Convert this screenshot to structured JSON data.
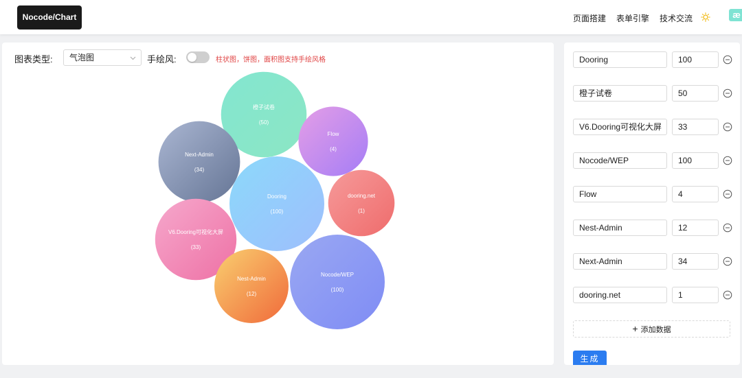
{
  "header": {
    "logo": "Nocode/Chart",
    "nav": [
      "页面搭建",
      "表单引擎",
      "技术交流"
    ],
    "brand_mark": "æ"
  },
  "controls": {
    "chart_type_label": "图表类型:",
    "chart_type_value": "气泡图",
    "hand_drawn_label": "手绘风:",
    "hand_drawn_enabled": false,
    "hand_drawn_hint": "柱状图，饼图，面积图支持手绘风格"
  },
  "chart_data": {
    "type": "bubble",
    "points": [
      {
        "name": "橙子试卷",
        "value": 50,
        "gradient": [
          "#83e6d0",
          "#8ce6c4"
        ]
      },
      {
        "name": "Flow",
        "value": 4,
        "gradient": [
          "#e49ee6",
          "#a57df6"
        ]
      },
      {
        "name": "Next-Admin",
        "value": 34,
        "gradient": [
          "#aab6d2",
          "#657595"
        ]
      },
      {
        "name": "Dooring",
        "value": 100,
        "gradient": [
          "#8cd9fb",
          "#9ebefc"
        ]
      },
      {
        "name": "dooring.net",
        "value": 1,
        "gradient": [
          "#f69a9a",
          "#ef6c6c"
        ]
      },
      {
        "name": "V6.Dooring可视化大屏",
        "value": 33,
        "gradient": [
          "#f6a8cc",
          "#ee71a5"
        ]
      },
      {
        "name": "Nest-Admin",
        "value": 12,
        "gradient": [
          "#f9cf70",
          "#f06a3a"
        ]
      },
      {
        "name": "Nocode/WEP",
        "value": 100,
        "gradient": [
          "#9aa8f2",
          "#7f8cf5"
        ]
      }
    ]
  },
  "data_rows": [
    {
      "name": "Dooring",
      "value": "100"
    },
    {
      "name": "橙子试卷",
      "value": "50"
    },
    {
      "name": "V6.Dooring可视化大屏",
      "value": "33"
    },
    {
      "name": "Nocode/WEP",
      "value": "100"
    },
    {
      "name": "Flow",
      "value": "4"
    },
    {
      "name": "Nest-Admin",
      "value": "12"
    },
    {
      "name": "Next-Admin",
      "value": "34"
    },
    {
      "name": "dooring.net",
      "value": "1"
    }
  ],
  "actions": {
    "add_label": "添加数据",
    "generate_label": "生成"
  }
}
